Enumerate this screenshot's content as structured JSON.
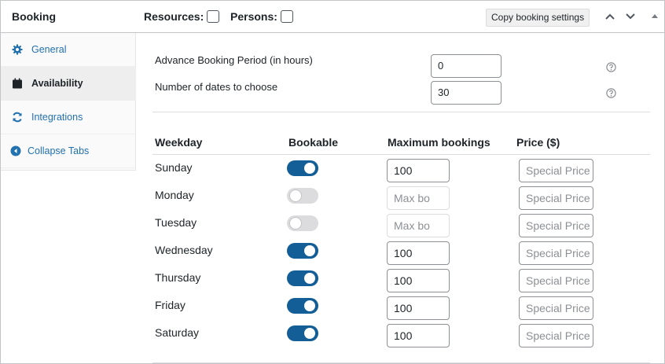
{
  "header": {
    "title": "Booking",
    "resources_label": "Resources:",
    "persons_label": "Persons:",
    "copy_button": "Copy booking settings"
  },
  "sidebar": {
    "items": [
      {
        "label": "General",
        "icon": "gear-icon"
      },
      {
        "label": "Availability",
        "icon": "calendar-icon"
      },
      {
        "label": "Integrations",
        "icon": "sync-icon"
      },
      {
        "label": "Collapse Tabs",
        "icon": "collapse-icon"
      }
    ]
  },
  "settings": {
    "advance_label": "Advance Booking Period (in hours)",
    "advance_value": "0",
    "dates_label": "Number of dates to choose",
    "dates_value": "30"
  },
  "table": {
    "headers": {
      "weekday": "Weekday",
      "bookable": "Bookable",
      "max": "Maximum bookings",
      "price": "Price ($)"
    },
    "rows": [
      {
        "day": "Sunday",
        "bookable": true,
        "max": "100",
        "price_placeholder": "Special Price"
      },
      {
        "day": "Monday",
        "bookable": false,
        "max": "Max bo",
        "price_placeholder": "Special Price"
      },
      {
        "day": "Tuesday",
        "bookable": false,
        "max": "Max bo",
        "price_placeholder": "Special Price"
      },
      {
        "day": "Wednesday",
        "bookable": true,
        "max": "100",
        "price_placeholder": "Special Price"
      },
      {
        "day": "Thursday",
        "bookable": true,
        "max": "100",
        "price_placeholder": "Special Price"
      },
      {
        "day": "Friday",
        "bookable": true,
        "max": "100",
        "price_placeholder": "Special Price"
      },
      {
        "day": "Saturday",
        "bookable": true,
        "max": "100",
        "price_placeholder": "Special Price"
      }
    ]
  },
  "colors": {
    "accent": "#135e96",
    "link": "#2271b1",
    "toggle_off": "#dcdcde"
  }
}
